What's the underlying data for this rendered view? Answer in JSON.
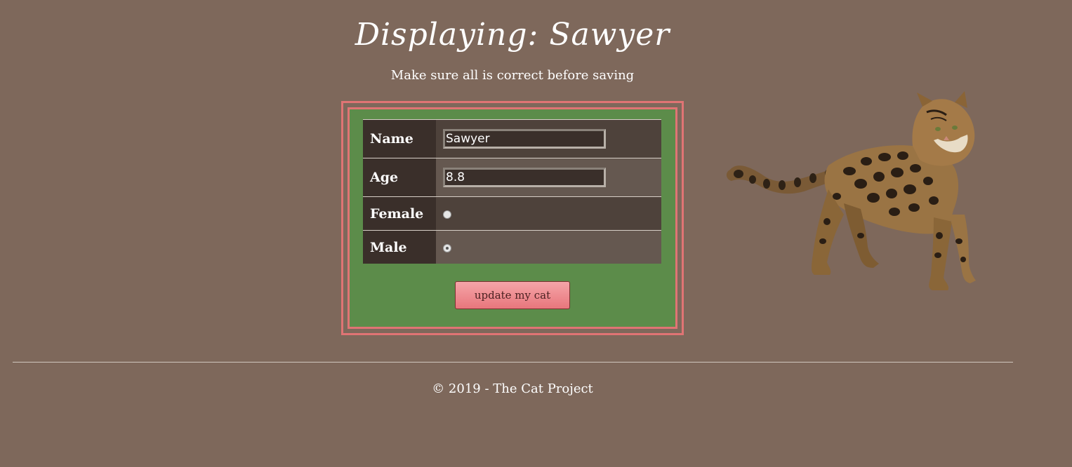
{
  "header": {
    "title": "Displaying: Sawyer",
    "subtitle": "Make sure all is correct before saving"
  },
  "form": {
    "name_label": "Name",
    "name_value": "Sawyer",
    "age_label": "Age",
    "age_value": "8.8",
    "female_label": "Female",
    "male_label": "Male",
    "selected_gender": "Male",
    "submit_label": "update my cat"
  },
  "image": {
    "icon": "bengal-cat-photo"
  },
  "footer": {
    "copyright": "© 2019 - The Cat Project"
  },
  "colors": {
    "background": "#7e685b",
    "form_border": "#e07474",
    "form_fill": "#5c8c4a",
    "button": "#e8767c"
  }
}
